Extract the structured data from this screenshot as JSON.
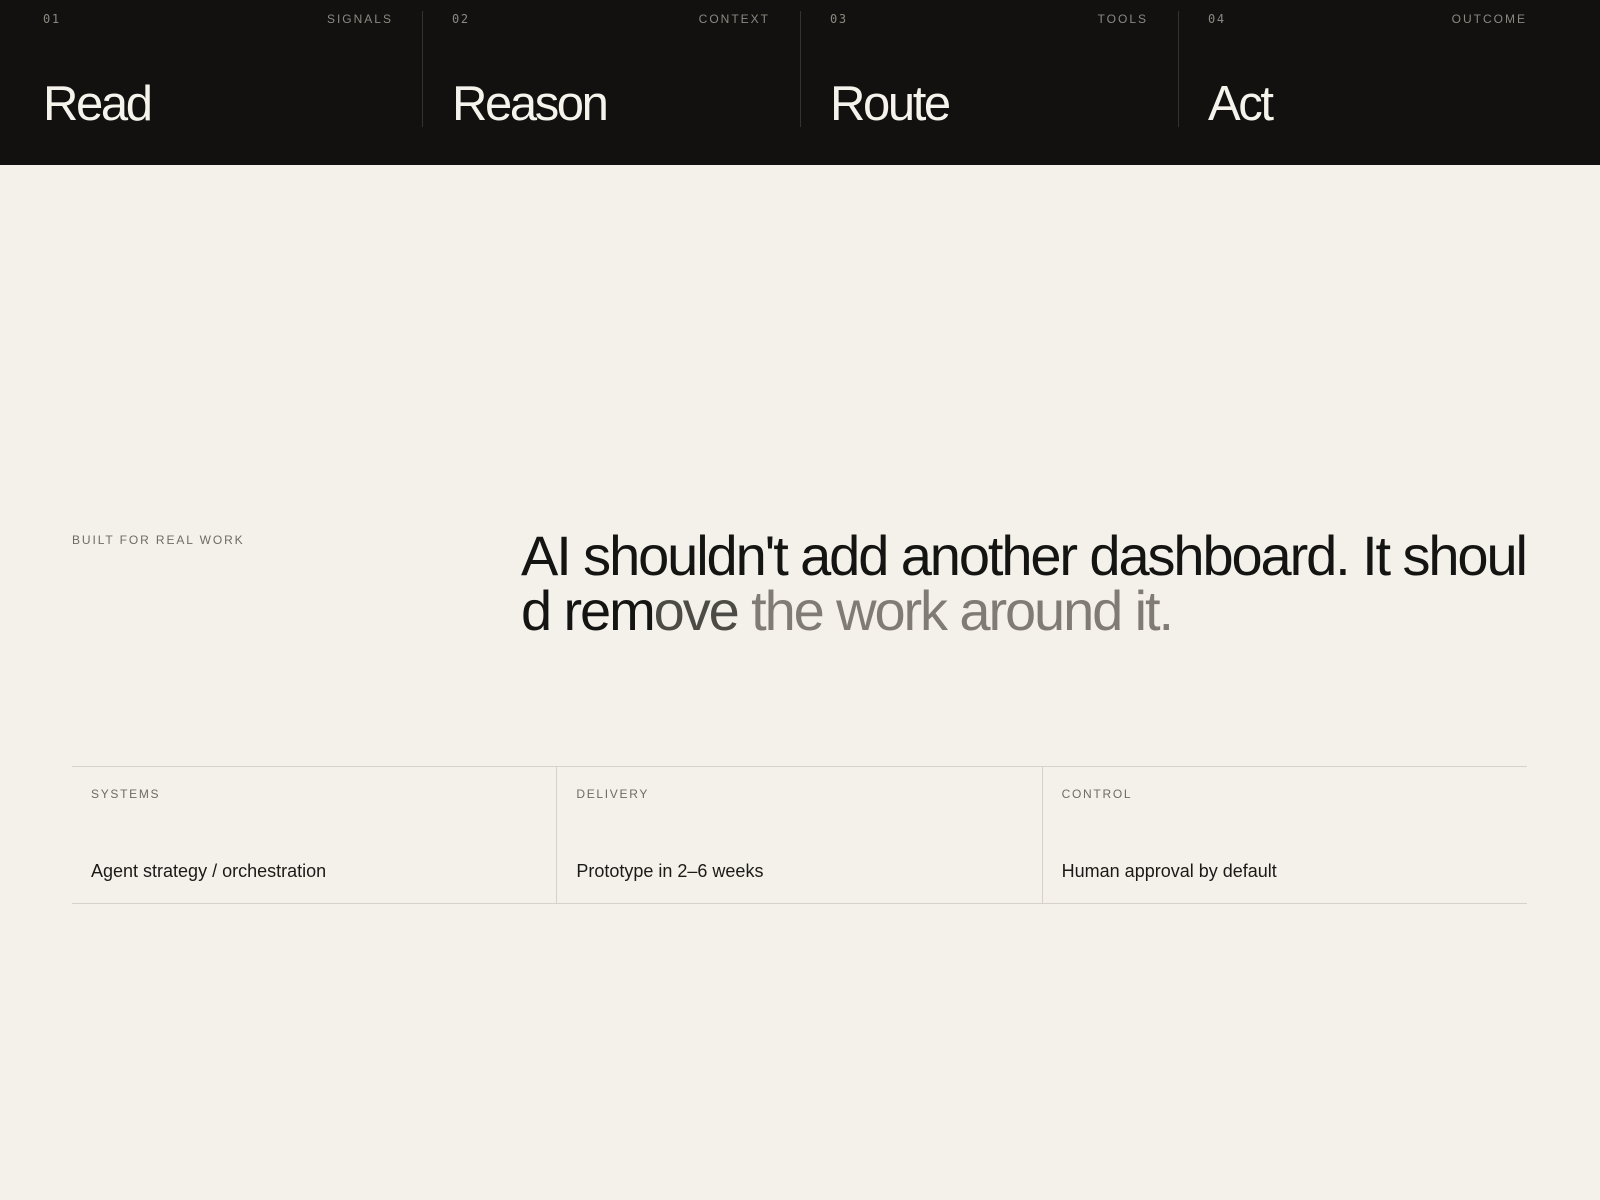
{
  "stages": [
    {
      "number": "01",
      "tag": "SIGNALS",
      "title": "Read"
    },
    {
      "number": "02",
      "tag": "CONTEXT",
      "title": "Reason"
    },
    {
      "number": "03",
      "tag": "TOOLS",
      "title": "Route"
    },
    {
      "number": "04",
      "tag": "OUTCOME",
      "title": "Act"
    }
  ],
  "hero": {
    "eyebrow": "BUILT FOR REAL WORK",
    "headline_dark": "AI shouldn't add another dashboard. It should rem",
    "headline_mid": "ove",
    "headline_faded": " the work around it."
  },
  "specs": [
    {
      "label": "SYSTEMS",
      "value": "Agent strategy / orchestration"
    },
    {
      "label": "DELIVERY",
      "value": "Prototype in 2–6 weeks"
    },
    {
      "label": "CONTROL",
      "value": "Human approval by default"
    }
  ],
  "colors": {
    "band_background": "#12110f",
    "page_background": "#f4f1ea",
    "headline_dark": "#141412",
    "headline_faded": "#807c75"
  }
}
